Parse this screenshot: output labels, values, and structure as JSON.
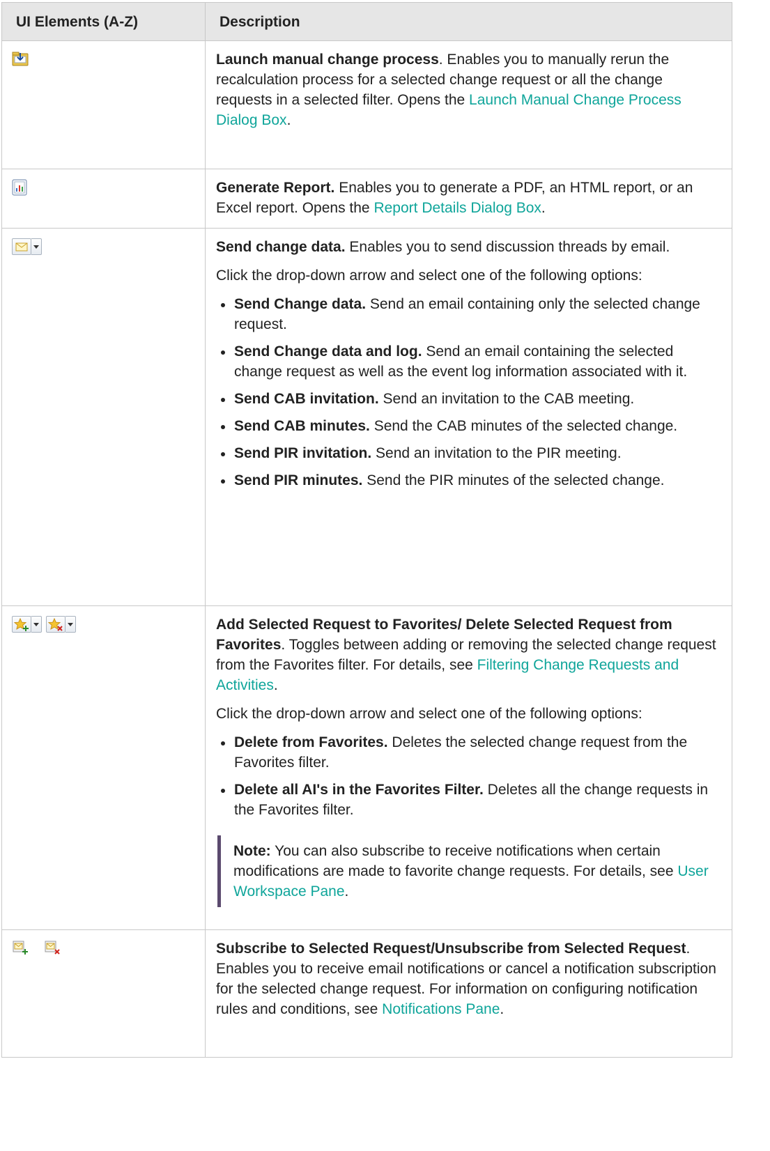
{
  "header": {
    "col1": "UI Elements (A-Z)",
    "col2": "Description"
  },
  "rows": [
    {
      "icon": "launch-folder-icon",
      "title": "Launch manual change process",
      "after_title": ". Enables you to manually rerun the recalculation process for a selected change request or all the change requests in a selected filter. Opens the ",
      "link": "Launch Manual Change Process Dialog Box",
      "end": "."
    },
    {
      "icon": "report-chart-icon",
      "title": "Generate Report.",
      "after_title": " Enables you to generate a PDF, an HTML report, or an Excel report. Opens the ",
      "link": "Report Details Dialog Box",
      "end": "."
    },
    {
      "icon": "envelope-icon",
      "title": "Send change data.",
      "after_title": " Enables you to send discussion threads by email.",
      "intro": "Click the drop-down arrow and select one of the following options:",
      "options": [
        {
          "bold": "Send Change data.",
          "text": " Send an email containing only the selected change request."
        },
        {
          "bold": "Send Change data and log.",
          "text": " Send an email containing the selected change request as well as the event log information associated with it."
        },
        {
          "bold": "Send CAB invitation.",
          "text": " Send an invitation to the CAB meeting."
        },
        {
          "bold": "Send CAB minutes.",
          "text": " Send the CAB minutes of the selected change."
        },
        {
          "bold": "Send PIR invitation.",
          "text": " Send an invitation to the PIR meeting."
        },
        {
          "bold": "Send PIR minutes.",
          "text": " Send the PIR minutes of the selected change."
        }
      ]
    },
    {
      "icon": "favorites-star-icon",
      "title": "Add Selected Request to Favorites/ Delete Selected Request from Favorites",
      "after_title": ". Toggles between adding or removing the selected change request from the Favorites filter. For details, see ",
      "link": "Filtering Change Requests and Activities",
      "end": ".",
      "intro": "Click the drop-down arrow and select one of the following options:",
      "options": [
        {
          "bold": "Delete from Favorites.",
          "text": " Deletes the selected change request from the Favorites filter."
        },
        {
          "bold": "Delete all AI's in the Favorites Filter.",
          "text": " Deletes all the change requests in the Favorites filter."
        }
      ],
      "note": {
        "bold": "Note:",
        "text": " You can also subscribe to receive notifications when certain modifications are made to favorite change requests. For details, see ",
        "link": "User Workspace Pane",
        "end": "."
      }
    },
    {
      "icon": "subscribe-mail-icon",
      "title": "Subscribe to Selected Request/Unsubscribe from Selected Request",
      "after_title": ". Enables you to receive email notifications or cancel a notification subscription for the selected change request. For information on configuring notification rules and conditions, see ",
      "link": "Notifications Pane",
      "end": "."
    }
  ]
}
